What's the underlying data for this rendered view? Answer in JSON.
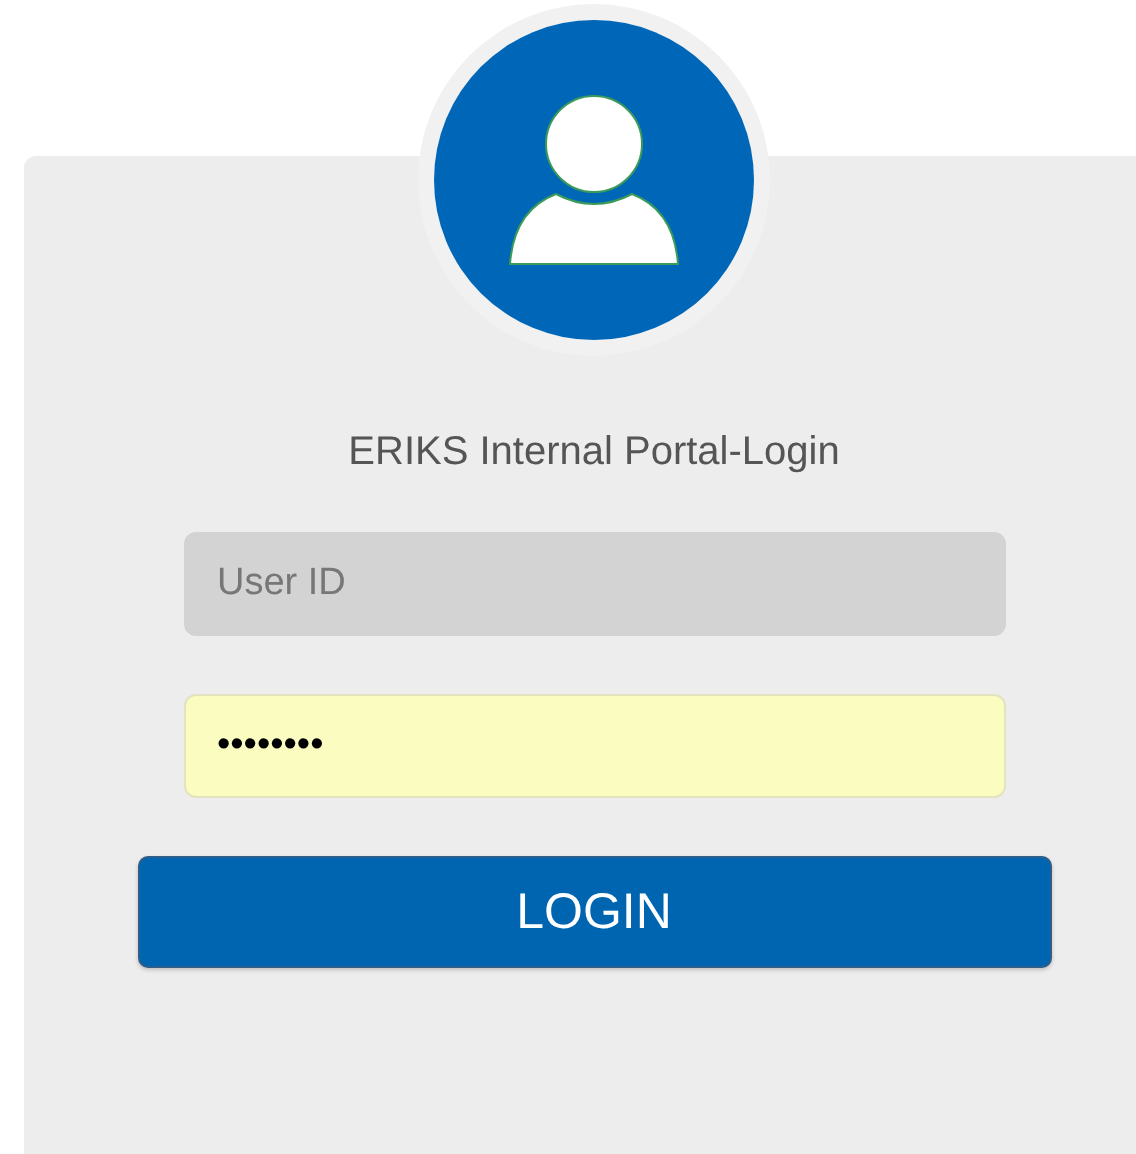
{
  "title": "ERIKS Internal Portal-Login",
  "fields": [
    {
      "placeholder": "User ID",
      "autofilled": false
    },
    {
      "value": "••••••••",
      "autofilled": true
    }
  ],
  "button": "LOGIN"
}
